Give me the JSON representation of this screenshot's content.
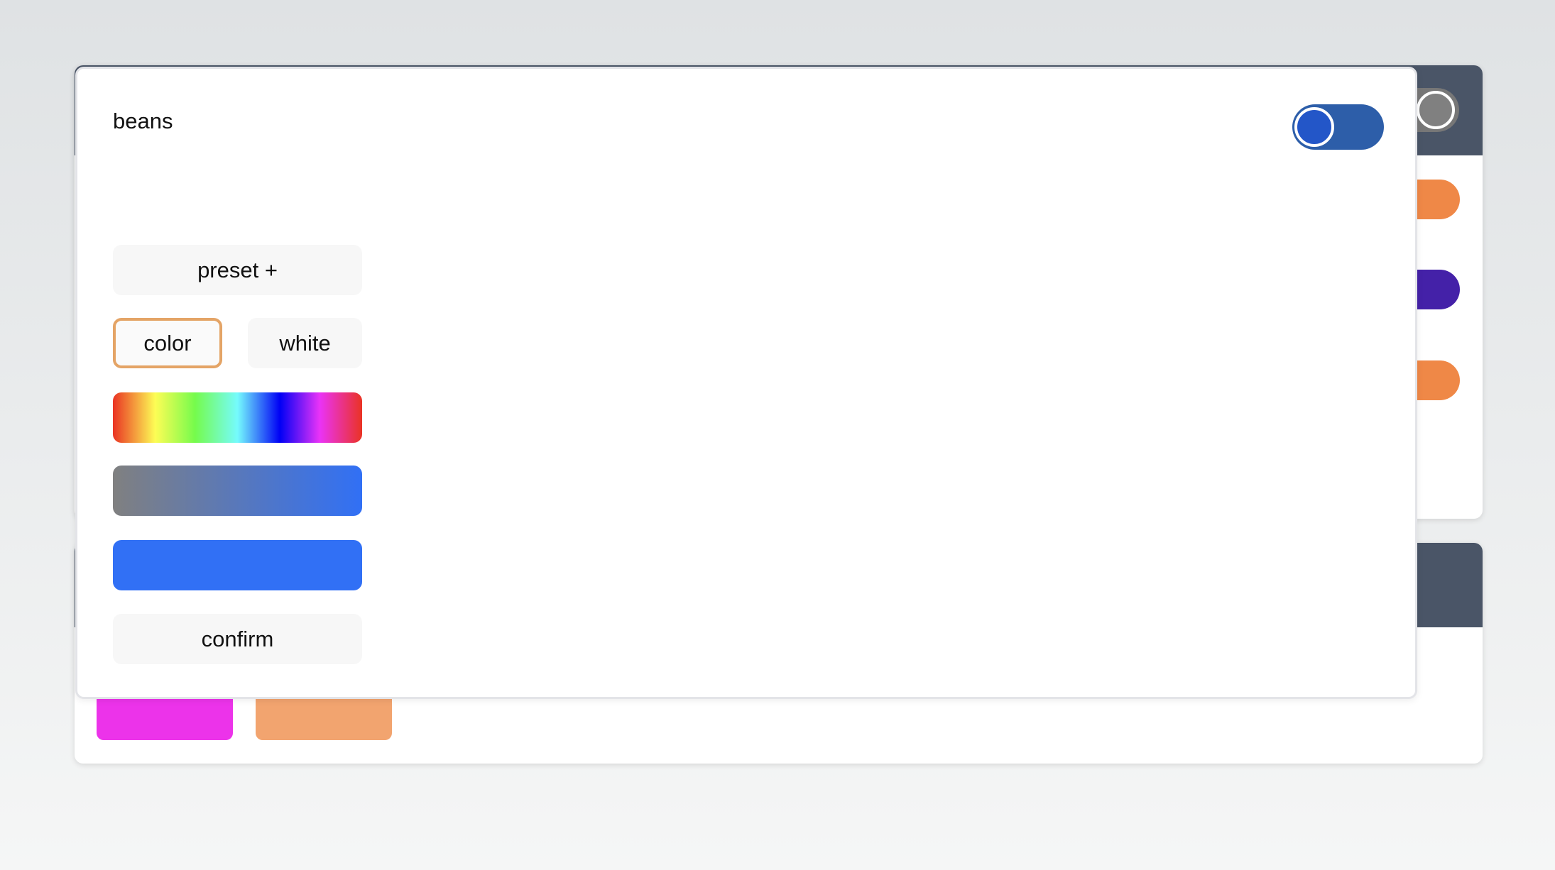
{
  "dialog": {
    "title": "beans",
    "toggle_on": true,
    "buttons": {
      "preset": "preset +",
      "color": "color",
      "white": "white",
      "confirm": "confirm"
    },
    "selected_mode": "color"
  },
  "colors": {
    "toggle_track": "#2d5ea9",
    "toggle_knob": "#2356c8",
    "solid_bar": "#3170f5",
    "selected_border": "#e4a466",
    "header": "#4a5567",
    "pill_orange": "#ef8847",
    "pill_purple": "#4421a8",
    "swatch_magenta": "#ec33ea",
    "swatch_orange": "#f2a46f"
  }
}
